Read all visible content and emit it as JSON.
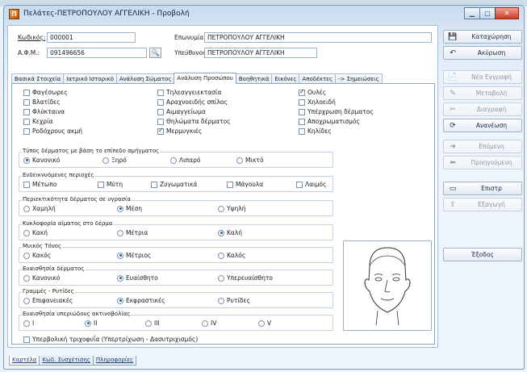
{
  "window": {
    "title": "Πελάτες-ΠΕΤΡΟΠΟΥΛΟΥ ΑΓΓΕΛΙΚΗ - Προβολή"
  },
  "header": {
    "code_label": "Κωδικός:",
    "code_value": "000001",
    "name_label": "Επωνυμία:",
    "name_value": "ΠΕΤΡΟΠΟΥΛΟΥ ΑΓΓΕΛΙΚΗ",
    "afm_label": "Α.Φ.Μ.:",
    "afm_value": "091496656",
    "resp_label": "Υπεύθυνος:",
    "resp_value": "ΠΕΤΡΟΠΟΥΛΟΥ ΑΓΓΕΛΙΚΗ",
    "lookup": "🔍"
  },
  "tabs": [
    "Βασικά Στοιχεία",
    "Ιατρικό Ιστορικό",
    "Ανάλυση Σώματος",
    "Ανάλυση Προσώπου",
    "Βοηθητικά",
    "Εικόνες",
    "Αποδέκτες",
    "-> Σημειώσεις"
  ],
  "problems": [
    {
      "label": "Φαγέσωρες",
      "checked": false
    },
    {
      "label": "Τηλεαγγειεκτασία",
      "checked": false
    },
    {
      "label": "Ουλές",
      "checked": true
    },
    {
      "label": "Βλατίδες",
      "checked": false
    },
    {
      "label": "Αραχνοειδής σπίλος",
      "checked": false
    },
    {
      "label": "Χηλοειδή",
      "checked": false
    },
    {
      "label": "Φλύκταινα",
      "checked": false
    },
    {
      "label": "Αιμαγγείωμα",
      "checked": false
    },
    {
      "label": "Υπέρχρωση δέρματος",
      "checked": false
    },
    {
      "label": "Κεχρία",
      "checked": false
    },
    {
      "label": "Θηλώματα δέρματος",
      "checked": false
    },
    {
      "label": "Αποχρωματισμός",
      "checked": false
    },
    {
      "label": "Ροδόχρους ακμή",
      "checked": false
    },
    {
      "label": "Μερμυγκιές",
      "checked": true
    },
    {
      "label": "Κηλίδες",
      "checked": false
    }
  ],
  "skin_type": {
    "title": "Τύπος δέρματος με βάση το επίπεδο σμήγματος",
    "options": [
      "Κανονικό",
      "Ξηρό",
      "Λιπαρό",
      "Μικτό"
    ],
    "selected": 0
  },
  "sensitive_areas": {
    "title": "Ενδεικνυόμενες περιοχές",
    "options": [
      {
        "label": "Μέτωπο",
        "checked": false
      },
      {
        "label": "Μύτη",
        "checked": false
      },
      {
        "label": "Ζυγωματικά",
        "checked": false
      },
      {
        "label": "Μάγουλα",
        "checked": false
      },
      {
        "label": "Λαιμός",
        "checked": false
      }
    ]
  },
  "moisture": {
    "title": "Περιεκτικότητα δέρματος σε υγρασία",
    "options": [
      "Χαμηλή",
      "Μέση",
      "Υψηλή"
    ],
    "selected": 1
  },
  "circulation": {
    "title": "Κυκλοφορία αίματος στο δέρμα",
    "options": [
      "Κακή",
      "Μέτρια",
      "Καλή"
    ],
    "selected": 2
  },
  "muscle_tone": {
    "title": "Μυικός Τόνος",
    "options": [
      "Κακός",
      "Μέτριος",
      "Καλός"
    ],
    "selected": 1
  },
  "sensitivity": {
    "title": "Ευαισθησία δέρματος",
    "options": [
      "Κανονικό",
      "Ευαίσθητο",
      "Υπερευαίσθητο"
    ],
    "selected": 1
  },
  "lines": {
    "title": "Γραμμές - Ρυτίδες",
    "options": [
      "Επιφανειακές",
      "Εκφραστικές",
      "Ρυτίδες"
    ],
    "selected": 1
  },
  "uv": {
    "title": "Ευαισθησία υπεριώδους ακτινοβολίας",
    "options": [
      "I",
      "II",
      "III",
      "IV",
      "V"
    ],
    "selected": 1
  },
  "hair": {
    "label": "Υπερβολική τριχοφυΐα (Υπερτρίχωση - Δασυτριχισμός)",
    "checked": false
  },
  "bottom_tabs": [
    "Καρτέλα",
    "Κωδ. Συσχέτισης",
    "Πληροφορίες"
  ],
  "sidebar": [
    {
      "label": "Καταχώρηση",
      "icon": "💾",
      "enabled": true
    },
    {
      "label": "Ακύρωση",
      "icon": "↶",
      "enabled": true
    },
    {
      "label": "Νέα Εγγραφή",
      "icon": "📄",
      "enabled": false
    },
    {
      "label": "Μεταβολή",
      "icon": "✎",
      "enabled": false
    },
    {
      "label": "Διαγραφή",
      "icon": "✂",
      "enabled": false
    },
    {
      "label": "Ανανέωση",
      "icon": "⟳",
      "enabled": true
    },
    {
      "label": "Επόμενη",
      "icon": "➜",
      "enabled": false
    },
    {
      "label": "Προηγούμενη",
      "icon": "⬅",
      "enabled": false
    },
    {
      "label": "Επιστρ",
      "icon": "▭",
      "enabled": true
    },
    {
      "label": "Εξαγωγή",
      "icon": "⇪",
      "enabled": false
    },
    {
      "label": "Έξοδος",
      "icon": "",
      "enabled": true
    }
  ],
  "window_buttons": {
    "minimize": "▁",
    "maximize": "□",
    "close": "✕"
  }
}
